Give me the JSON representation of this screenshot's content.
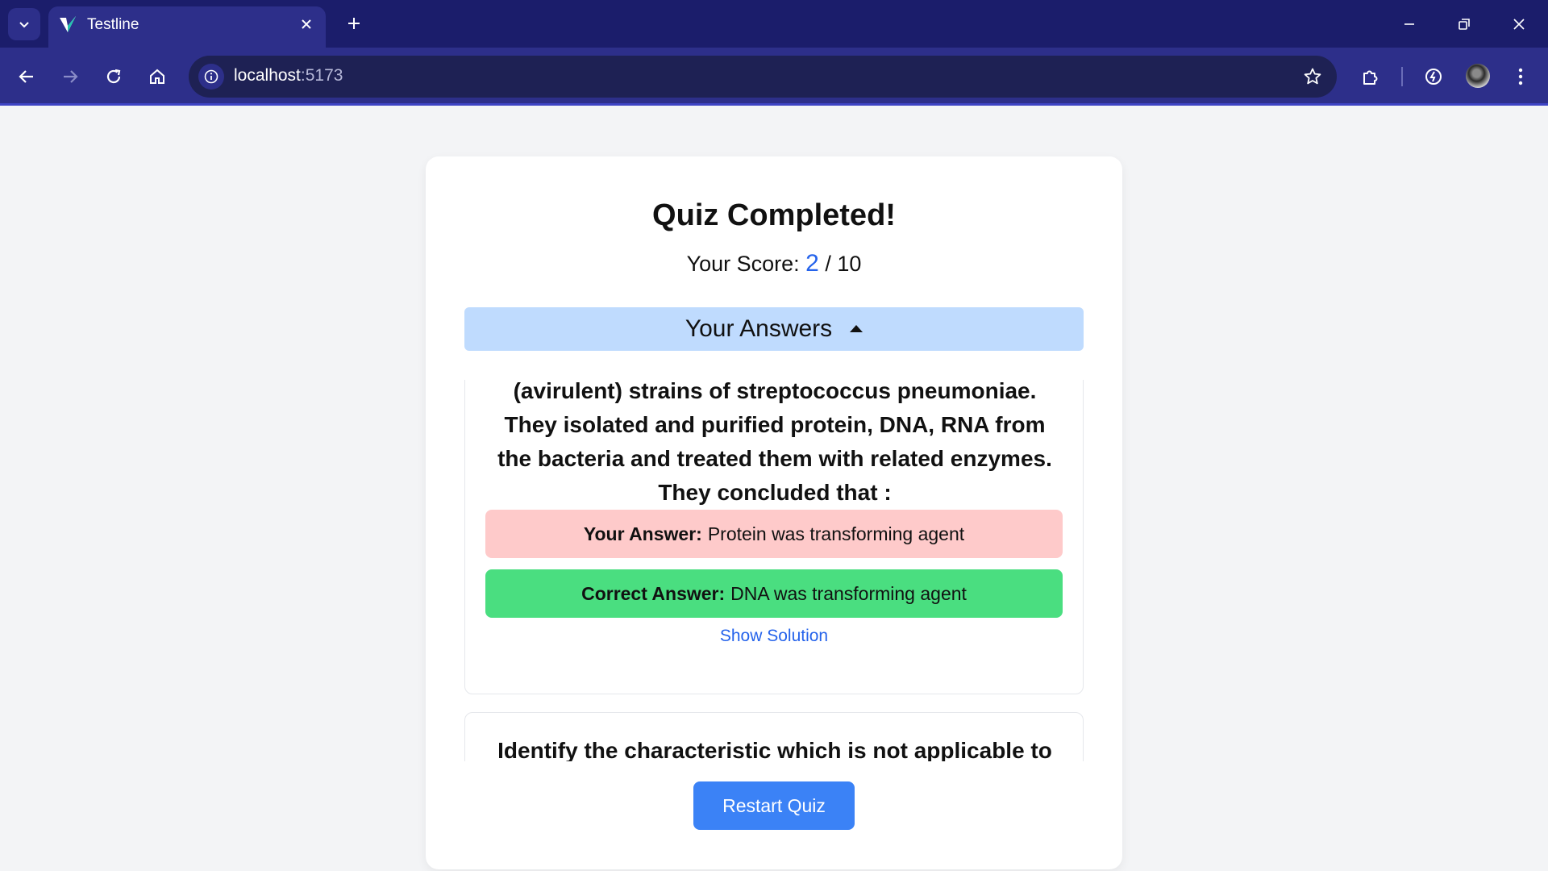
{
  "browser": {
    "tab_title": "Testline",
    "url_host": "localhost",
    "url_port": ":5173"
  },
  "quiz": {
    "title": "Quiz Completed!",
    "score_label": "Your Score:",
    "score_value": "2",
    "score_total": "/ 10",
    "answers_toggle_label": "Your Answers",
    "restart_label": "Restart Quiz"
  },
  "answers": [
    {
      "question_visible": "(avirulent) strains of streptococcus pneumoniae. They isolated and purified protein, DNA, RNA from the bacteria and treated them with related enzymes. They concluded that :",
      "your_answer_label": "Your Answer:",
      "your_answer": "Protein was transforming agent",
      "correct_answer_label": "Correct Answer:",
      "correct_answer": "DNA was transforming agent",
      "solution_link": "Show Solution"
    },
    {
      "question_visible": "Identify the characteristic which is not applicable to the"
    }
  ],
  "colors": {
    "tabstrip": "#1b1d6b",
    "toolbar": "#2d2f8a",
    "page_bg": "#f3f4f6",
    "score_accent": "#2563eb",
    "answers_toggle_bg": "#bfdbfe",
    "wrong_answer_bg": "#fecaca",
    "correct_answer_bg": "#4ade80",
    "restart_button_bg": "#3b82f6"
  }
}
